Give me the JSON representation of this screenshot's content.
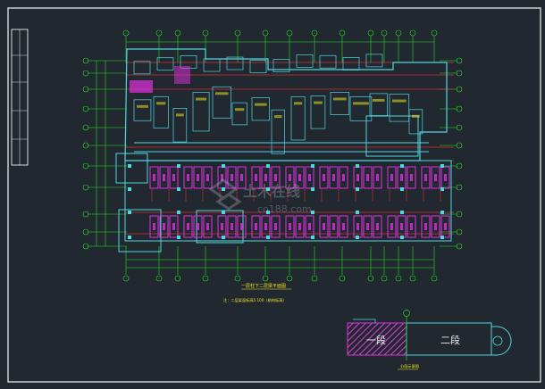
{
  "segment_key": {
    "first_segment": "一段",
    "second_segment": "二段",
    "caption": "分段示意图"
  },
  "notes": {
    "line1": "一层柱下二层梁平面图",
    "line2": "注：二层梁面标高5.100（结构标高）"
  },
  "watermark": {
    "brand_cn": "土木在线",
    "brand_url": "co188.com"
  },
  "colors": {
    "background": "#222830",
    "frame": "#d8d8d8",
    "grid_axis": "#22dd22",
    "wall": "#4ed8e0",
    "beam_red": "#d83030",
    "parking_magenta": "#e030e0",
    "label_yellow": "#e8e020"
  }
}
